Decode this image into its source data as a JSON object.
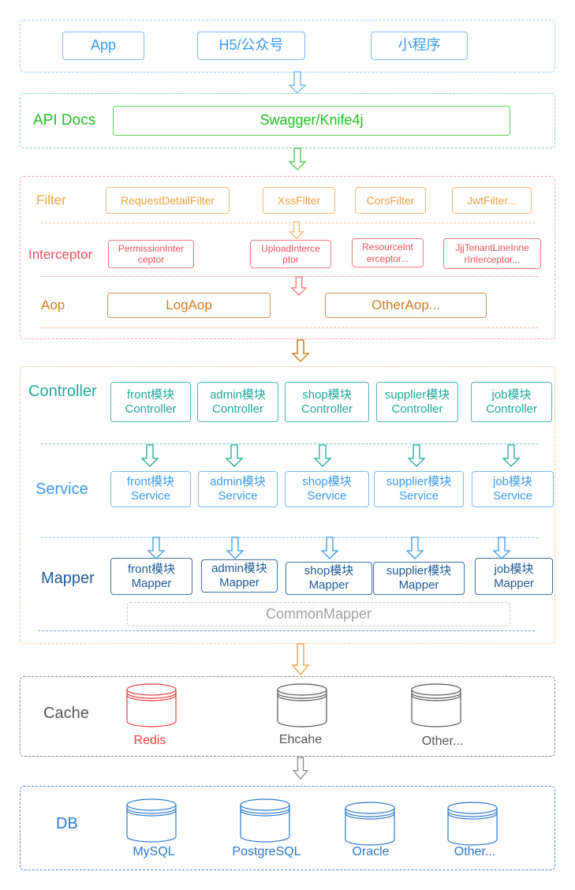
{
  "colors": {
    "client": "#4da3f5",
    "apidocs": "#2ec12e",
    "filter": "#f0a040",
    "interceptor": "#f0505a",
    "aop": "#d07c1e",
    "controller": "#1fa89a",
    "service": "#3a99ee",
    "mapper": "#1f5a9a",
    "common": "#a0a0a0",
    "cache": "#555555",
    "redis": "#f03c3c",
    "db": "#2a78cc"
  },
  "client_layer": {
    "items": [
      "App",
      "H5/公众号",
      "小程序"
    ]
  },
  "api_docs": {
    "title": "API Docs",
    "item": "Swagger/Knife4j"
  },
  "web_layer": {
    "filter": {
      "title": "Filter",
      "items": [
        "RequestDetailFilter",
        "XssFilter",
        "CorsFilter",
        "JwtFilter..."
      ]
    },
    "interceptor": {
      "title": "Interceptor",
      "items": [
        [
          "PermissionInter",
          "ceptor"
        ],
        [
          "UploadInterce",
          "ptor"
        ],
        [
          "ResourceInt",
          "erceptor..."
        ],
        [
          "JjjTenantLineInne",
          "rInterceptor..."
        ]
      ]
    },
    "aop": {
      "title": "Aop",
      "items": [
        "LogAop",
        "OtherAop..."
      ]
    }
  },
  "app_layer": {
    "controller": {
      "title": "Controller",
      "items": [
        [
          "front模块",
          "Controller"
        ],
        [
          "admin模块",
          "Controller"
        ],
        [
          "shop模块",
          "Controller"
        ],
        [
          "supplier模块",
          "Controller"
        ],
        [
          "job模块",
          "Controller"
        ]
      ]
    },
    "service": {
      "title": "Service",
      "items": [
        [
          "front模块",
          "Service"
        ],
        [
          "admin模块",
          "Service"
        ],
        [
          "shop模块",
          "Service"
        ],
        [
          "supplier模块",
          "Service"
        ],
        [
          "job模块",
          "Service"
        ]
      ]
    },
    "mapper": {
      "title": "Mapper",
      "items": [
        [
          "front模块",
          "Mapper"
        ],
        [
          "admin模块",
          "Mapper"
        ],
        [
          "shop模块",
          "Mapper"
        ],
        [
          "supplier模块",
          "Mapper"
        ],
        [
          "job模块",
          "Mapper"
        ]
      ],
      "common": "CommonMapper"
    }
  },
  "cache_layer": {
    "title": "Cache",
    "items": [
      "Redis",
      "Ehcahe",
      "Other..."
    ]
  },
  "db_layer": {
    "title": "DB",
    "items": [
      "MySQL",
      "PostgreSQL",
      "Oracle",
      "Other..."
    ]
  }
}
